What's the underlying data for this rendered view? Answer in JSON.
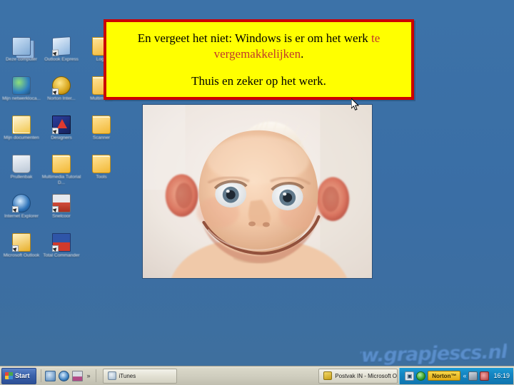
{
  "desktop": {
    "background_color": "#3a6ea5",
    "icons": [
      {
        "label": "Deze computer",
        "icon": "my-computer-icon",
        "art": "ic-computer",
        "shortcut": false
      },
      {
        "label": "Outlook Express",
        "icon": "outlook-express-icon",
        "art": "ic-outlook",
        "shortcut": true
      },
      {
        "label": "Logo",
        "icon": "folder-icon",
        "art": "ic-folder",
        "shortcut": false
      },
      {
        "label": "Mijn netwerkloca...",
        "icon": "my-network-places-icon",
        "art": "ic-network",
        "shortcut": false
      },
      {
        "label": "Norton Inter...",
        "icon": "norton-internet-security-icon",
        "art": "ic-norton",
        "shortcut": true
      },
      {
        "label": "Multimedia",
        "icon": "folder-icon",
        "art": "ic-folder",
        "shortcut": false
      },
      {
        "label": "Mijn documenten",
        "icon": "my-documents-icon",
        "art": "ic-docs",
        "shortcut": false
      },
      {
        "label": "Designers",
        "icon": "designers-app-icon",
        "art": "ic-designers",
        "shortcut": true
      },
      {
        "label": "Scanner",
        "icon": "folder-icon",
        "art": "ic-folder",
        "shortcut": false
      },
      {
        "label": "Prullenbak",
        "icon": "recycle-bin-icon",
        "art": "ic-bin",
        "shortcut": false
      },
      {
        "label": "Multimedia Tutorial D...",
        "icon": "folder-icon",
        "art": "ic-folder",
        "shortcut": false
      },
      {
        "label": "Tools",
        "icon": "folder-icon",
        "art": "ic-folder",
        "shortcut": false
      },
      {
        "label": "Internet Explorer",
        "icon": "internet-explorer-icon",
        "art": "ic-ie",
        "shortcut": true
      },
      {
        "label": "Snelcoor",
        "icon": "snelcoor-icon",
        "art": "ic-snel",
        "shortcut": true
      },
      {
        "label": "",
        "icon": "",
        "art": "",
        "shortcut": false
      },
      {
        "label": "Microsoft Outlook",
        "icon": "microsoft-outlook-icon",
        "art": "ic-msoutlook",
        "shortcut": true
      },
      {
        "label": "Total Commander",
        "icon": "total-commander-icon",
        "art": "ic-tc",
        "shortcut": true
      },
      {
        "label": "",
        "icon": "",
        "art": "",
        "shortcut": false
      }
    ]
  },
  "callout": {
    "background_color": "#ffff00",
    "border_color": "#cc0000",
    "line1_prefix": "En vergeet het niet: Windows is er om het werk ",
    "line1_highlight": "te vergemakkelijken",
    "line1_suffix": ".",
    "line2": "Thuis en zeker op het werk."
  },
  "photo": {
    "alt": "Bewerkte foto van een lachende baby met groot hoofd",
    "caption": ""
  },
  "watermark": {
    "text": "www.grapjescs.nl",
    "color": "#5a8ecb"
  },
  "taskbar": {
    "start_label": "Start",
    "quick_launch": [
      {
        "name": "media-player-icon",
        "art": "qli-media"
      },
      {
        "name": "internet-explorer-icon",
        "art": "qli-ie"
      },
      {
        "name": "save-disk-icon",
        "art": "qli-save"
      }
    ],
    "quick_launch_overflow": "»",
    "tasks": [
      {
        "label": "iTunes",
        "icon": "itunes-icon",
        "art": "tbi-itunes"
      },
      {
        "label": "Postvak IN - Microsoft O...",
        "icon": "outlook-icon",
        "art": "tbi-outlook"
      }
    ],
    "tray": {
      "items": [
        {
          "name": "display-properties-icon",
          "art": "tri-box",
          "glyph": "▣"
        },
        {
          "name": "norton-shield-icon",
          "art": "tri-green",
          "glyph": ""
        }
      ],
      "norton_label": "Norton™",
      "chevron": "«",
      "extra_icons": [
        {
          "name": "network-icon",
          "art": "tri-net"
        },
        {
          "name": "volume-icon",
          "art": "tri-vol"
        }
      ],
      "clock": "16:19"
    }
  }
}
